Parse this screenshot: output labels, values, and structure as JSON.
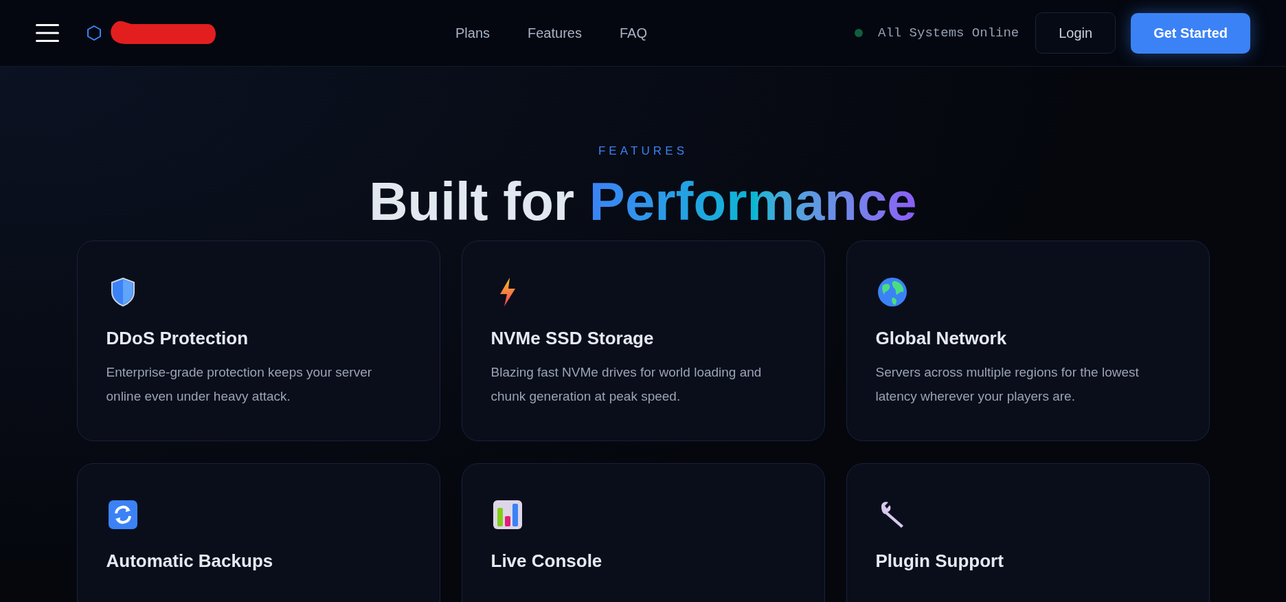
{
  "nav": {
    "links": [
      "Plans",
      "Features",
      "FAQ"
    ],
    "status": {
      "label": "All Systems Online",
      "color": "#0f5f3c"
    },
    "login": "Login",
    "cta": "Get Started"
  },
  "section": {
    "eyebrow": "FEATURES",
    "title_plain": "Built for",
    "title_accent": "Performance"
  },
  "features": [
    {
      "kind": "shield",
      "title": "DDoS Protection",
      "text": "Enterprise-grade protection keeps your server online even under heavy attack."
    },
    {
      "kind": "bolt",
      "title": "NVMe SSD Storage",
      "text": "Blazing fast NVMe drives for world loading and chunk generation at peak speed."
    },
    {
      "kind": "globe",
      "title": "Global Network",
      "text": "Servers across multiple regions for the lowest latency wherever your players are."
    },
    {
      "kind": "sync",
      "title": "Automatic Backups"
    },
    {
      "kind": "chart",
      "title": "Live Console"
    },
    {
      "kind": "wrench",
      "title": "Plugin Support"
    }
  ]
}
